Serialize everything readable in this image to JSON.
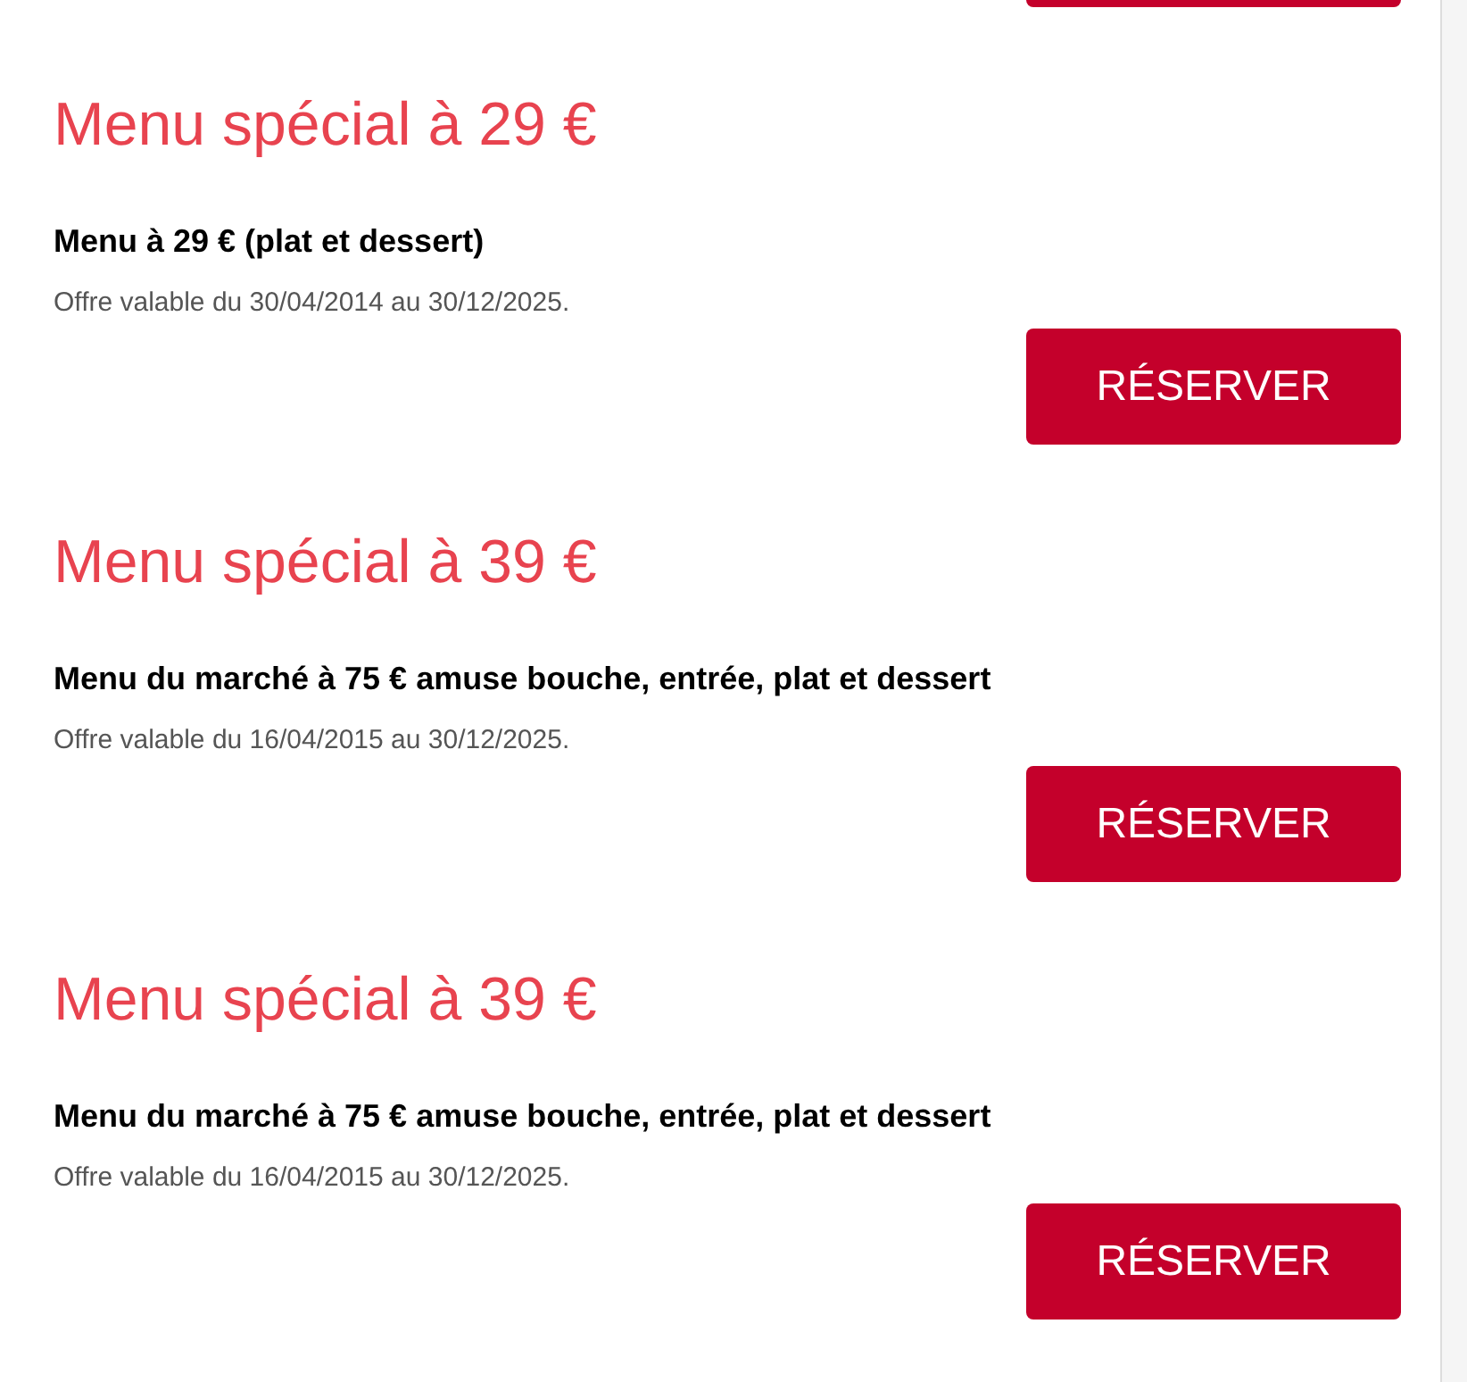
{
  "offers": [
    {
      "title": "Menu spécial à 29 €",
      "name": "Menu à 29 € (plat et dessert)",
      "validity": "Offre valable du 30/04/2014 au 30/12/2025.",
      "button": "RÉSERVER"
    },
    {
      "title": "Menu spécial à 39 €",
      "name": "Menu du marché à 75 € amuse bouche, entrée, plat et dessert",
      "validity": "Offre valable du 16/04/2015 au 30/12/2025.",
      "button": "RÉSERVER"
    },
    {
      "title": "Menu spécial à 39 €",
      "name": "Menu du marché à 75 € amuse bouche, entrée, plat et dessert",
      "validity": "Offre valable du 16/04/2015 au 30/12/2025.",
      "button": "RÉSERVER"
    }
  ]
}
